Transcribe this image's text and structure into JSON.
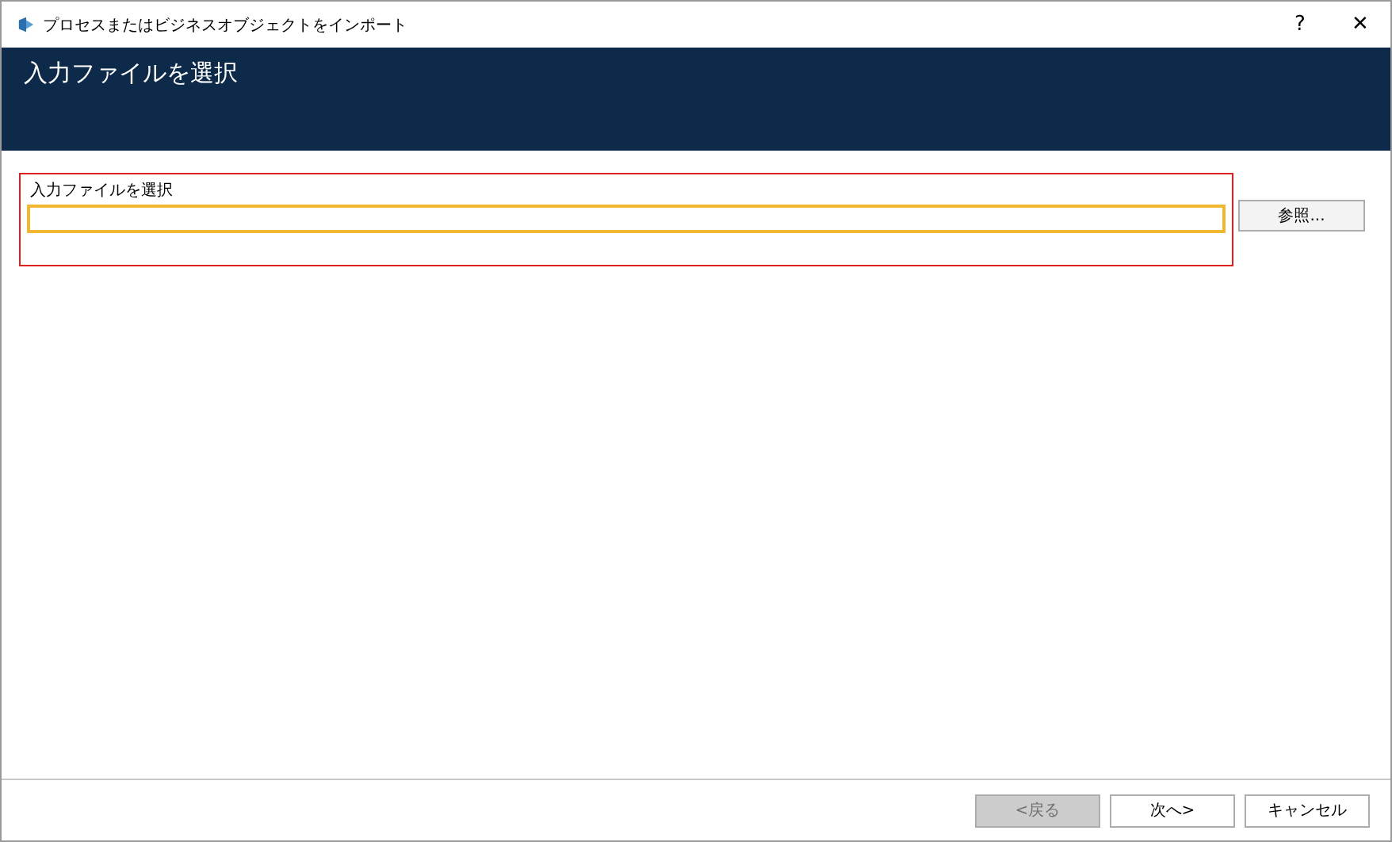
{
  "window": {
    "title": "プロセスまたはビジネスオブジェクトをインポート",
    "help": "?",
    "close": "✕"
  },
  "header": {
    "title": "入力ファイルを選択"
  },
  "file_field": {
    "label": "入力ファイルを選択",
    "highlighted": true,
    "focused": true
  },
  "browse_button": {
    "label": "参照..."
  },
  "buttons": [
    {
      "label": "<戻る",
      "disabled": true
    },
    {
      "label": "次へ>",
      "disabled": false
    },
    {
      "label": "キャンセル",
      "disabled": false
    }
  ]
}
